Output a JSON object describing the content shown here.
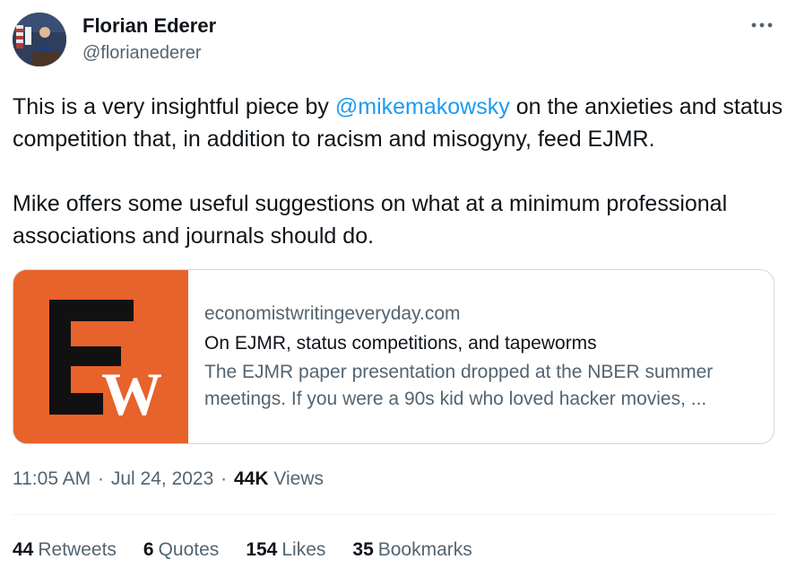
{
  "author": {
    "name": "Florian Ederer",
    "handle": "@florianederer",
    "avatar": "avatar-photo-podium"
  },
  "tweet": {
    "text_part1": "This is a very insightful piece by ",
    "mention": "@mikemakowsky",
    "text_part2": " on the anxieties and status competition that, in addition to racism and misogyny, feed EJMR.",
    "paragraph2": "Mike offers some useful suggestions on what at a minimum professional associations and journals should do."
  },
  "link_card": {
    "domain": "economistwritingeveryday.com",
    "title": "On EJMR, status competitions, and tapeworms",
    "description": "The EJMR paper presentation dropped at the NBER summer meetings. If you were a 90s kid who loved hacker movies, ...",
    "thumbnail_logo": "EW",
    "thumbnail_bg": "#e8622b"
  },
  "meta": {
    "time": "11:05 AM",
    "date": "Jul 24, 2023",
    "views_count": "44K",
    "views_label": "Views",
    "separator": "·"
  },
  "stats": [
    {
      "count": "44",
      "label": "Retweets"
    },
    {
      "count": "6",
      "label": "Quotes"
    },
    {
      "count": "154",
      "label": "Likes"
    },
    {
      "count": "35",
      "label": "Bookmarks"
    }
  ],
  "icons": {
    "more": "more-horizontal-icon"
  },
  "colors": {
    "text_primary": "#0f1419",
    "text_secondary": "#536471",
    "link_blue": "#1d9bf0",
    "border": "#cfd9de"
  }
}
